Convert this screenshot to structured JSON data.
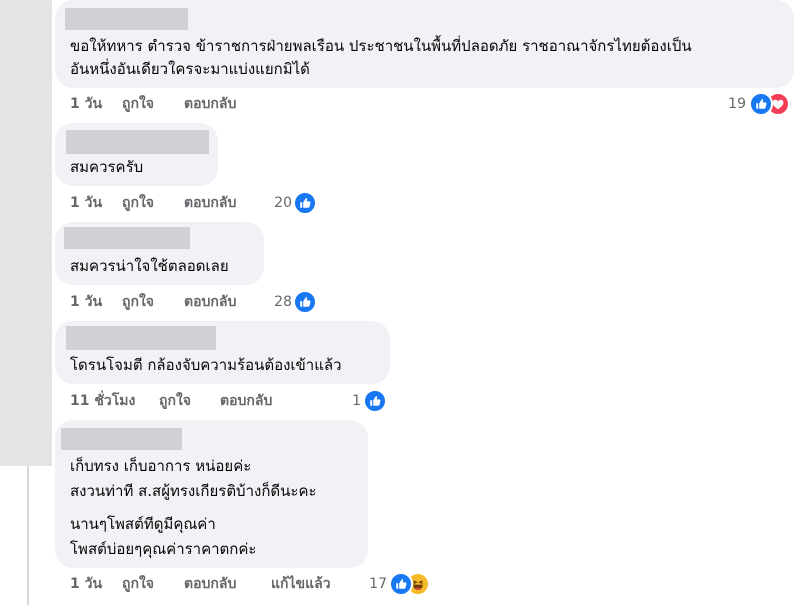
{
  "comments": [
    {
      "text_lines": [
        "ขอให้ทหาร ตำรวจ ข้าราชการฝ่ายพลเรือน ประชาชนในพื้นที่ปลอดภัย ราชอาณาจักรไทยต้องเป็น",
        "อันหนึ่งอันเดียวใครจะมาแบ่งแยกมิได้"
      ],
      "time": "1 วัน",
      "like_label": "ถูกใจ",
      "reply_label": "ตอบกลับ",
      "reaction_count": "19",
      "reactions": [
        "like-icon",
        "love-icon"
      ]
    },
    {
      "text_lines": [
        "สมควรครับ"
      ],
      "time": "1 วัน",
      "like_label": "ถูกใจ",
      "reply_label": "ตอบกลับ",
      "reaction_count": "20",
      "reactions": [
        "like-icon"
      ]
    },
    {
      "text_lines": [
        "สมควรน่าใจใช้ตลอดเลย"
      ],
      "time": "1 วัน",
      "like_label": "ถูกใจ",
      "reply_label": "ตอบกลับ",
      "reaction_count": "28",
      "reactions": [
        "like-icon"
      ]
    },
    {
      "text_lines": [
        "โดรนโจมตี กล้องจับความร้อนต้องเข้าแล้ว"
      ],
      "time": "11 ชั่วโมง",
      "like_label": "ถูกใจ",
      "reply_label": "ตอบกลับ",
      "reaction_count": "1",
      "reactions": [
        "like-icon"
      ]
    },
    {
      "text_lines": [
        "เก็บทรง เก็บอาการ หน่อยค่ะ",
        "สงวนท่าที ส.สผู้ทรงเกียรติบ้างก็ดีนะคะ",
        "นานๆโพสต์ทีดูมีคุณค่า",
        "โพสต์บ่อยๆคุณค่าราคาตกค่ะ"
      ],
      "time": "1 วัน",
      "like_label": "ถูกใจ",
      "reply_label": "ตอบกลับ",
      "edited_label": "แก้ไขแล้ว",
      "reaction_count": "17",
      "reactions": [
        "like-icon",
        "haha-icon"
      ]
    }
  ],
  "colors": {
    "bubble": "#f0f2f5",
    "name_redaction": "#cfd1d4",
    "meta_text": "#65676b",
    "like_blue": "#1877f2",
    "love_red": "#f33e58",
    "haha_yellow": "#f7b928"
  }
}
